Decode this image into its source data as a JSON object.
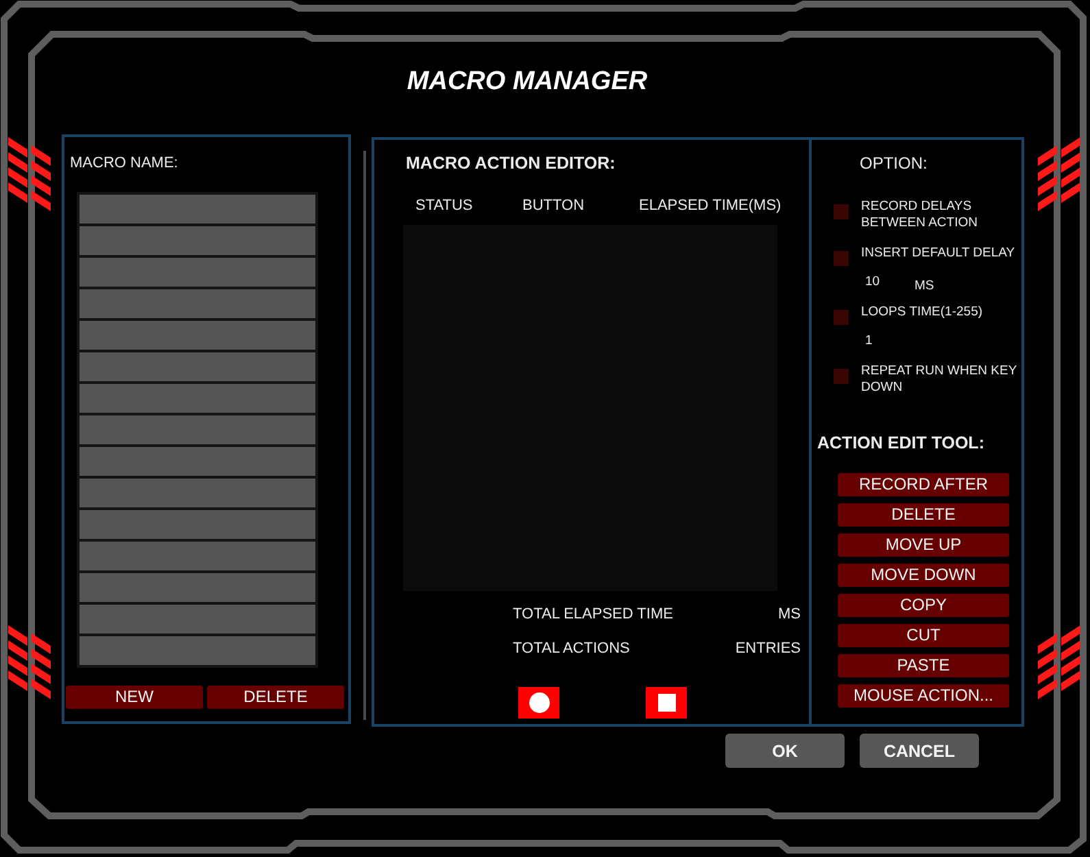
{
  "window": {
    "title": "MACRO MANAGER"
  },
  "macro_list": {
    "label": "MACRO NAME:",
    "slots": [
      {
        "selected": false
      },
      {
        "selected": false
      },
      {
        "selected": false
      },
      {
        "selected": false
      },
      {
        "selected": false
      },
      {
        "selected": false
      },
      {
        "selected": false
      },
      {
        "selected": false
      },
      {
        "selected": false
      },
      {
        "selected": false
      },
      {
        "selected": false
      },
      {
        "selected": false
      },
      {
        "selected": false
      },
      {
        "selected": false
      },
      {
        "selected": false
      }
    ],
    "buttons": [
      "NEW",
      "DELETE"
    ]
  },
  "action_editor": {
    "title": "MACRO ACTION EDITOR:",
    "columns": [
      "STATUS",
      "BUTTON",
      "ELAPSED TIME(MS)"
    ],
    "totals": [
      {
        "label": "TOTAL ELAPSED TIME",
        "unit": "MS"
      },
      {
        "label": "TOTAL ACTIONS",
        "unit": "ENTRIES"
      }
    ],
    "recorder_buttons": [
      {
        "kind": "record"
      },
      {
        "kind": "stop"
      }
    ]
  },
  "options": {
    "title": "OPTION:",
    "items": [
      {
        "label": "RECORD DELAYS BETWEEN ACTION",
        "checked": false
      },
      {
        "label": "INSERT DEFAULT DELAY",
        "checked": false,
        "value": "10",
        "unit": "MS"
      },
      {
        "label": "LOOPS TIME(1-255)",
        "checked": false,
        "value": "1"
      },
      {
        "label": "REPEAT RUN WHEN KEY DOWN",
        "checked": false
      }
    ]
  },
  "action_edit_tool": {
    "title": "ACTION EDIT TOOL:",
    "buttons": [
      "RECORD AFTER",
      "DELETE",
      "MOVE UP",
      "MOVE DOWN",
      "COPY",
      "CUT",
      "PASTE",
      "MOUSE ACTION..."
    ]
  },
  "dialog_buttons": [
    "OK",
    "CANCEL"
  ]
}
